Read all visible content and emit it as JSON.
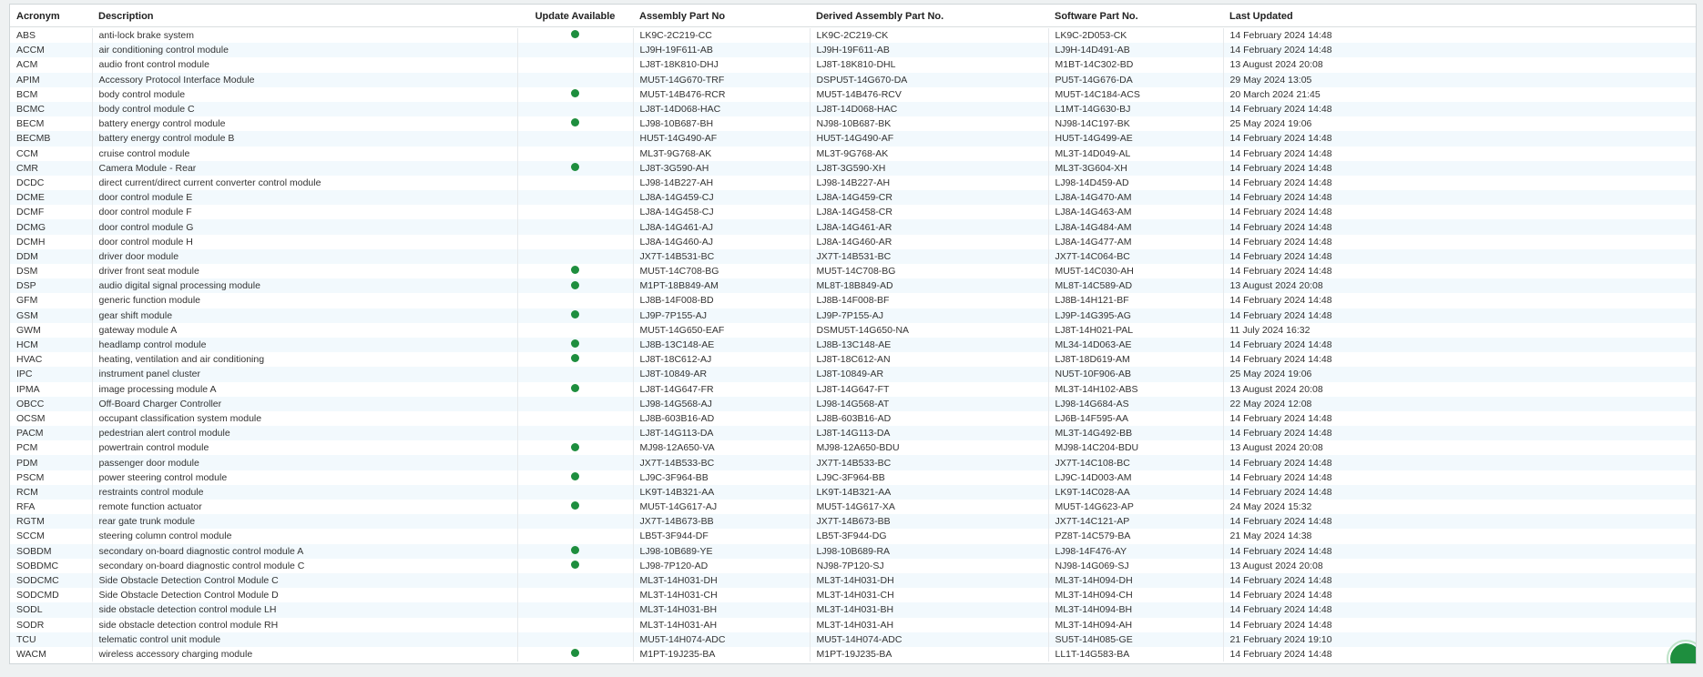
{
  "colors": {
    "update_dot": "#1e8e3e",
    "row_alt": "#f2f9fd"
  },
  "columns": {
    "acronym": "Acronym",
    "description": "Description",
    "update": "Update Available",
    "assembly": "Assembly Part No",
    "derived": "Derived Assembly Part No.",
    "software": "Software Part No.",
    "updated": "Last Updated"
  },
  "rows": [
    {
      "acronym": "ABS",
      "description": "anti-lock brake system",
      "update": true,
      "assembly": "LK9C-2C219-CC",
      "derived": "LK9C-2C219-CK",
      "software": "LK9C-2D053-CK",
      "updated": "14 February 2024 14:48"
    },
    {
      "acronym": "ACCM",
      "description": "air conditioning control module",
      "update": false,
      "assembly": "LJ9H-19F611-AB",
      "derived": "LJ9H-19F611-AB",
      "software": "LJ9H-14D491-AB",
      "updated": "14 February 2024 14:48"
    },
    {
      "acronym": "ACM",
      "description": "audio front control module",
      "update": false,
      "assembly": "LJ8T-18K810-DHJ",
      "derived": "LJ8T-18K810-DHL",
      "software": "M1BT-14C302-BD",
      "updated": "13 August 2024 20:08"
    },
    {
      "acronym": "APIM",
      "description": "Accessory Protocol Interface Module",
      "update": false,
      "assembly": "MU5T-14G670-TRF",
      "derived": "DSPU5T-14G670-DA",
      "software": "PU5T-14G676-DA",
      "updated": "29 May 2024 13:05"
    },
    {
      "acronym": "BCM",
      "description": "body control module",
      "update": true,
      "assembly": "MU5T-14B476-RCR",
      "derived": "MU5T-14B476-RCV",
      "software": "MU5T-14C184-ACS",
      "updated": "20 March 2024 21:45"
    },
    {
      "acronym": "BCMC",
      "description": "body control module C",
      "update": false,
      "assembly": "LJ8T-14D068-HAC",
      "derived": "LJ8T-14D068-HAC",
      "software": "L1MT-14G630-BJ",
      "updated": "14 February 2024 14:48"
    },
    {
      "acronym": "BECM",
      "description": "battery energy control module",
      "update": true,
      "assembly": "LJ98-10B687-BH",
      "derived": "NJ98-10B687-BK",
      "software": "NJ98-14C197-BK",
      "updated": "25 May 2024 19:06"
    },
    {
      "acronym": "BECMB",
      "description": "battery energy control module B",
      "update": false,
      "assembly": "HU5T-14G490-AF",
      "derived": "HU5T-14G490-AF",
      "software": "HU5T-14G499-AE",
      "updated": "14 February 2024 14:48"
    },
    {
      "acronym": "CCM",
      "description": "cruise control module",
      "update": false,
      "assembly": "ML3T-9G768-AK",
      "derived": "ML3T-9G768-AK",
      "software": "ML3T-14D049-AL",
      "updated": "14 February 2024 14:48"
    },
    {
      "acronym": "CMR",
      "description": "Camera Module - Rear",
      "update": true,
      "assembly": "LJ8T-3G590-AH",
      "derived": "LJ8T-3G590-XH",
      "software": "ML3T-3G604-XH",
      "updated": "14 February 2024 14:48"
    },
    {
      "acronym": "DCDC",
      "description": "direct current/direct current converter control module",
      "update": false,
      "assembly": "LJ98-14B227-AH",
      "derived": "LJ98-14B227-AH",
      "software": "LJ98-14D459-AD",
      "updated": "14 February 2024 14:48"
    },
    {
      "acronym": "DCME",
      "description": "door control module E",
      "update": false,
      "assembly": "LJ8A-14G459-CJ",
      "derived": "LJ8A-14G459-CR",
      "software": "LJ8A-14G470-AM",
      "updated": "14 February 2024 14:48"
    },
    {
      "acronym": "DCMF",
      "description": "door control module F",
      "update": false,
      "assembly": "LJ8A-14G458-CJ",
      "derived": "LJ8A-14G458-CR",
      "software": "LJ8A-14G463-AM",
      "updated": "14 February 2024 14:48"
    },
    {
      "acronym": "DCMG",
      "description": "door control module G",
      "update": false,
      "assembly": "LJ8A-14G461-AJ",
      "derived": "LJ8A-14G461-AR",
      "software": "LJ8A-14G484-AM",
      "updated": "14 February 2024 14:48"
    },
    {
      "acronym": "DCMH",
      "description": "door control module H",
      "update": false,
      "assembly": "LJ8A-14G460-AJ",
      "derived": "LJ8A-14G460-AR",
      "software": "LJ8A-14G477-AM",
      "updated": "14 February 2024 14:48"
    },
    {
      "acronym": "DDM",
      "description": "driver door module",
      "update": false,
      "assembly": "JX7T-14B531-BC",
      "derived": "JX7T-14B531-BC",
      "software": "JX7T-14C064-BC",
      "updated": "14 February 2024 14:48"
    },
    {
      "acronym": "DSM",
      "description": "driver front seat module",
      "update": true,
      "assembly": "MU5T-14C708-BG",
      "derived": "MU5T-14C708-BG",
      "software": "MU5T-14C030-AH",
      "updated": "14 February 2024 14:48"
    },
    {
      "acronym": "DSP",
      "description": "audio digital signal processing module",
      "update": true,
      "assembly": "M1PT-18B849-AM",
      "derived": "ML8T-18B849-AD",
      "software": "ML8T-14C589-AD",
      "updated": "13 August 2024 20:08"
    },
    {
      "acronym": "GFM",
      "description": "generic function module",
      "update": false,
      "assembly": "LJ8B-14F008-BD",
      "derived": "LJ8B-14F008-BF",
      "software": "LJ8B-14H121-BF",
      "updated": "14 February 2024 14:48"
    },
    {
      "acronym": "GSM",
      "description": "gear shift module",
      "update": true,
      "assembly": "LJ9P-7P155-AJ",
      "derived": "LJ9P-7P155-AJ",
      "software": "LJ9P-14G395-AG",
      "updated": "14 February 2024 14:48"
    },
    {
      "acronym": "GWM",
      "description": "gateway module A",
      "update": false,
      "assembly": "MU5T-14G650-EAF",
      "derived": "DSMU5T-14G650-NA",
      "software": "LJ8T-14H021-PAL",
      "updated": "11 July 2024 16:32"
    },
    {
      "acronym": "HCM",
      "description": "headlamp control module",
      "update": true,
      "assembly": "LJ8B-13C148-AE",
      "derived": "LJ8B-13C148-AE",
      "software": "ML34-14D063-AE",
      "updated": "14 February 2024 14:48"
    },
    {
      "acronym": "HVAC",
      "description": "heating, ventilation and air conditioning",
      "update": true,
      "assembly": "LJ8T-18C612-AJ",
      "derived": "LJ8T-18C612-AN",
      "software": "LJ8T-18D619-AM",
      "updated": "14 February 2024 14:48"
    },
    {
      "acronym": "IPC",
      "description": "instrument panel cluster",
      "update": false,
      "assembly": "LJ8T-10849-AR",
      "derived": "LJ8T-10849-AR",
      "software": "NU5T-10F906-AB",
      "updated": "25 May 2024 19:06"
    },
    {
      "acronym": "IPMA",
      "description": "image processing module A",
      "update": true,
      "assembly": "LJ8T-14G647-FR",
      "derived": "LJ8T-14G647-FT",
      "software": "ML3T-14H102-ABS",
      "updated": "13 August 2024 20:08"
    },
    {
      "acronym": "OBCC",
      "description": "Off-Board Charger Controller",
      "update": false,
      "assembly": "LJ98-14G568-AJ",
      "derived": "LJ98-14G568-AT",
      "software": "LJ98-14G684-AS",
      "updated": "22 May 2024 12:08"
    },
    {
      "acronym": "OCSM",
      "description": "occupant classification system module",
      "update": false,
      "assembly": "LJ8B-603B16-AD",
      "derived": "LJ8B-603B16-AD",
      "software": "LJ6B-14F595-AA",
      "updated": "14 February 2024 14:48"
    },
    {
      "acronym": "PACM",
      "description": "pedestrian alert control module",
      "update": false,
      "assembly": "LJ8T-14G113-DA",
      "derived": "LJ8T-14G113-DA",
      "software": "ML3T-14G492-BB",
      "updated": "14 February 2024 14:48"
    },
    {
      "acronym": "PCM",
      "description": "powertrain control module",
      "update": true,
      "assembly": "MJ98-12A650-VA",
      "derived": "MJ98-12A650-BDU",
      "software": "MJ98-14C204-BDU",
      "updated": "13 August 2024 20:08"
    },
    {
      "acronym": "PDM",
      "description": "passenger door module",
      "update": false,
      "assembly": "JX7T-14B533-BC",
      "derived": "JX7T-14B533-BC",
      "software": "JX7T-14C108-BC",
      "updated": "14 February 2024 14:48"
    },
    {
      "acronym": "PSCM",
      "description": "power steering control module",
      "update": true,
      "assembly": "LJ9C-3F964-BB",
      "derived": "LJ9C-3F964-BB",
      "software": "LJ9C-14D003-AM",
      "updated": "14 February 2024 14:48"
    },
    {
      "acronym": "RCM",
      "description": "restraints control module",
      "update": false,
      "assembly": "LK9T-14B321-AA",
      "derived": "LK9T-14B321-AA",
      "software": "LK9T-14C028-AA",
      "updated": "14 February 2024 14:48"
    },
    {
      "acronym": "RFA",
      "description": "remote function actuator",
      "update": true,
      "assembly": "MU5T-14G617-AJ",
      "derived": "MU5T-14G617-XA",
      "software": "MU5T-14G623-AP",
      "updated": "24 May 2024 15:32"
    },
    {
      "acronym": "RGTM",
      "description": "rear gate trunk module",
      "update": false,
      "assembly": "JX7T-14B673-BB",
      "derived": "JX7T-14B673-BB",
      "software": "JX7T-14C121-AP",
      "updated": "14 February 2024 14:48"
    },
    {
      "acronym": "SCCM",
      "description": "steering column control module",
      "update": false,
      "assembly": "LB5T-3F944-DF",
      "derived": "LB5T-3F944-DG",
      "software": "PZ8T-14C579-BA",
      "updated": "21 May 2024 14:38"
    },
    {
      "acronym": "SOBDM",
      "description": "secondary on-board diagnostic control module A",
      "update": true,
      "assembly": "LJ98-10B689-YE",
      "derived": "LJ98-10B689-RA",
      "software": "LJ98-14F476-AY",
      "updated": "14 February 2024 14:48"
    },
    {
      "acronym": "SOBDMC",
      "description": "secondary on-board diagnostic control module C",
      "update": true,
      "assembly": "LJ98-7P120-AD",
      "derived": "NJ98-7P120-SJ",
      "software": "NJ98-14G069-SJ",
      "updated": "13 August 2024 20:08"
    },
    {
      "acronym": "SODCMC",
      "description": "Side Obstacle Detection Control Module C",
      "update": false,
      "assembly": "ML3T-14H031-DH",
      "derived": "ML3T-14H031-DH",
      "software": "ML3T-14H094-DH",
      "updated": "14 February 2024 14:48"
    },
    {
      "acronym": "SODCMD",
      "description": "Side Obstacle Detection Control Module D",
      "update": false,
      "assembly": "ML3T-14H031-CH",
      "derived": "ML3T-14H031-CH",
      "software": "ML3T-14H094-CH",
      "updated": "14 February 2024 14:48"
    },
    {
      "acronym": "SODL",
      "description": "side obstacle detection control module LH",
      "update": false,
      "assembly": "ML3T-14H031-BH",
      "derived": "ML3T-14H031-BH",
      "software": "ML3T-14H094-BH",
      "updated": "14 February 2024 14:48"
    },
    {
      "acronym": "SODR",
      "description": "side obstacle detection control module RH",
      "update": false,
      "assembly": "ML3T-14H031-AH",
      "derived": "ML3T-14H031-AH",
      "software": "ML3T-14H094-AH",
      "updated": "14 February 2024 14:48"
    },
    {
      "acronym": "TCU",
      "description": "telematic control unit module",
      "update": false,
      "assembly": "MU5T-14H074-ADC",
      "derived": "MU5T-14H074-ADC",
      "software": "SU5T-14H085-GE",
      "updated": "21 February 2024 19:10"
    },
    {
      "acronym": "WACM",
      "description": "wireless accessory charging module",
      "update": true,
      "assembly": "M1PT-19J235-BA",
      "derived": "M1PT-19J235-BA",
      "software": "LL1T-14G583-BA",
      "updated": "14 February 2024 14:48"
    }
  ]
}
